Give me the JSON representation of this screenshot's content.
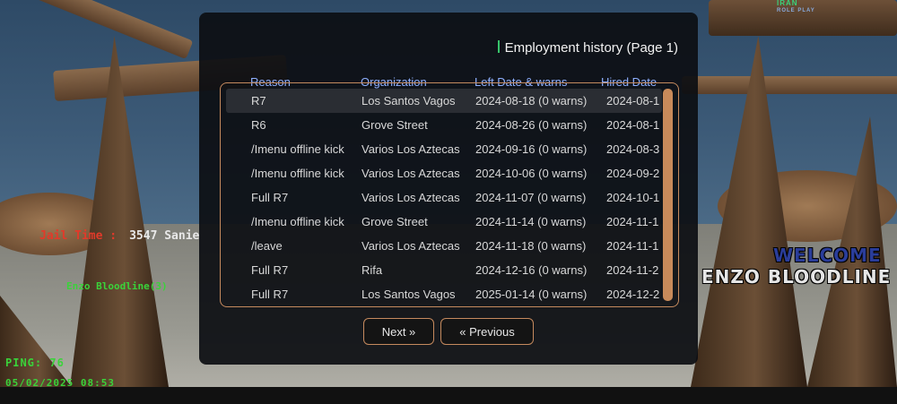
{
  "dialog": {
    "title": "Employment history (Page 1)",
    "columns": {
      "reason": "Reason",
      "organization": "Organization",
      "left_date": "Left Date & warns",
      "hired_date": "Hired Date"
    },
    "rows": [
      {
        "reason": "R7",
        "organization": "Los Santos Vagos",
        "left": "2024-08-18 (0 warns)",
        "hired": "2024-08-1"
      },
      {
        "reason": "R6",
        "organization": "Grove Street",
        "left": "2024-08-26 (0 warns)",
        "hired": "2024-08-1"
      },
      {
        "reason": "/Imenu offline kick",
        "organization": "Varios Los Aztecas",
        "left": "2024-09-16 (0 warns)",
        "hired": "2024-08-3"
      },
      {
        "reason": "/Imenu offline kick",
        "organization": "Varios Los Aztecas",
        "left": "2024-10-06 (0 warns)",
        "hired": "2024-09-2"
      },
      {
        "reason": "Full R7",
        "organization": "Varios Los Aztecas",
        "left": "2024-11-07 (0 warns)",
        "hired": "2024-10-1"
      },
      {
        "reason": "/Imenu offline kick",
        "organization": "Grove Street",
        "left": "2024-11-14 (0 warns)",
        "hired": "2024-11-1"
      },
      {
        "reason": "/leave",
        "organization": "Varios Los Aztecas",
        "left": "2024-11-18 (0 warns)",
        "hired": "2024-11-1"
      },
      {
        "reason": "Full R7",
        "organization": "Rifa",
        "left": "2024-12-16 (0 warns)",
        "hired": "2024-11-2"
      },
      {
        "reason": "Full R7",
        "organization": "Los Santos Vagos",
        "left": "2025-01-14 (0 warns)",
        "hired": "2024-12-2"
      }
    ],
    "buttons": {
      "next": "Next »",
      "previous": "« Previous"
    }
  },
  "hud": {
    "time_label": "Jail Time :",
    "time_value": "3547 Sanie",
    "player_tag": "Enzo Bloodline(3)",
    "ping": "PING: 76",
    "datetime": "05/02/2025 08:53",
    "welcome": "WELCOME",
    "player_name": "ENZO BLOODLINE",
    "logo_top": "IRAN",
    "logo_bottom": "ROLE PLAY"
  },
  "colors": {
    "accent": "#c58a5e",
    "header": "#8fb0ff",
    "title_marker": "#37c46b",
    "hud_green": "#3ad33a"
  }
}
